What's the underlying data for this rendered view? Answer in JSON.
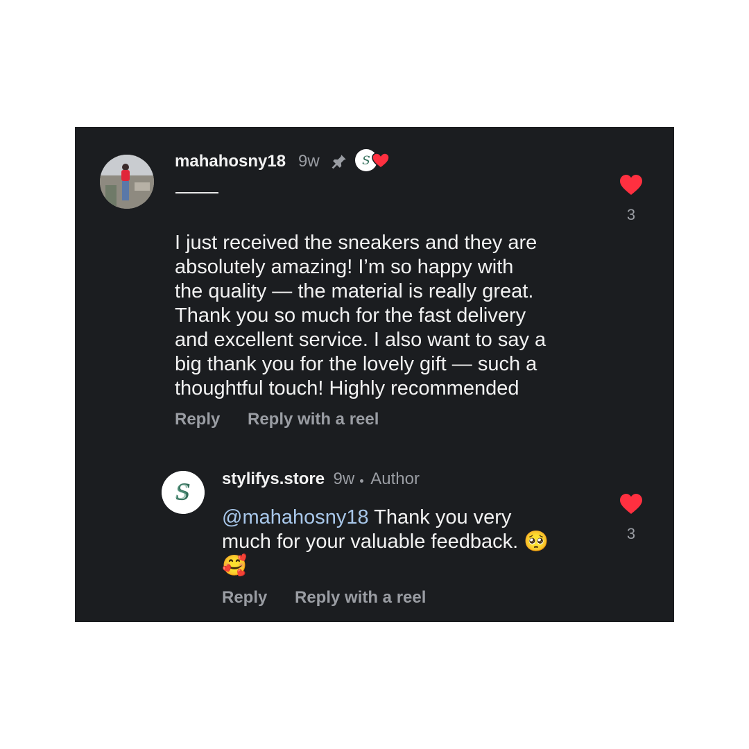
{
  "comment": {
    "username": "mahahosny18",
    "time": "9w",
    "pin_icon": "pin-icon",
    "creator_like_icon": "creator-liked-heart-icon",
    "text_lines": [
      "I just received the sneakers and they are",
      "absolutely amazing! I’m so happy with",
      "the quality — the material is really great.",
      "Thank you so much for the fast delivery",
      "and excellent service. I also want to say a",
      "big thank you for the lovely gift — such a",
      "thoughtful touch! Highly recommended"
    ],
    "reply_label": "Reply",
    "reply_reel_label": "Reply with a reel",
    "like_count": "3"
  },
  "reply": {
    "username": "stylifys.store",
    "time": "9w",
    "badge": "Author",
    "mention": "@mahahosny18",
    "text_line1": " Thank you very",
    "text_line2": "much for your valuable feedback. 🥺",
    "text_line3": "🥰",
    "reply_label": "Reply",
    "reply_reel_label": "Reply with a reel",
    "like_count": "3"
  },
  "colors": {
    "background": "#1b1d20",
    "heart": "#ff3040",
    "mention": "#a8c7ea",
    "muted": "#9a9da3"
  }
}
